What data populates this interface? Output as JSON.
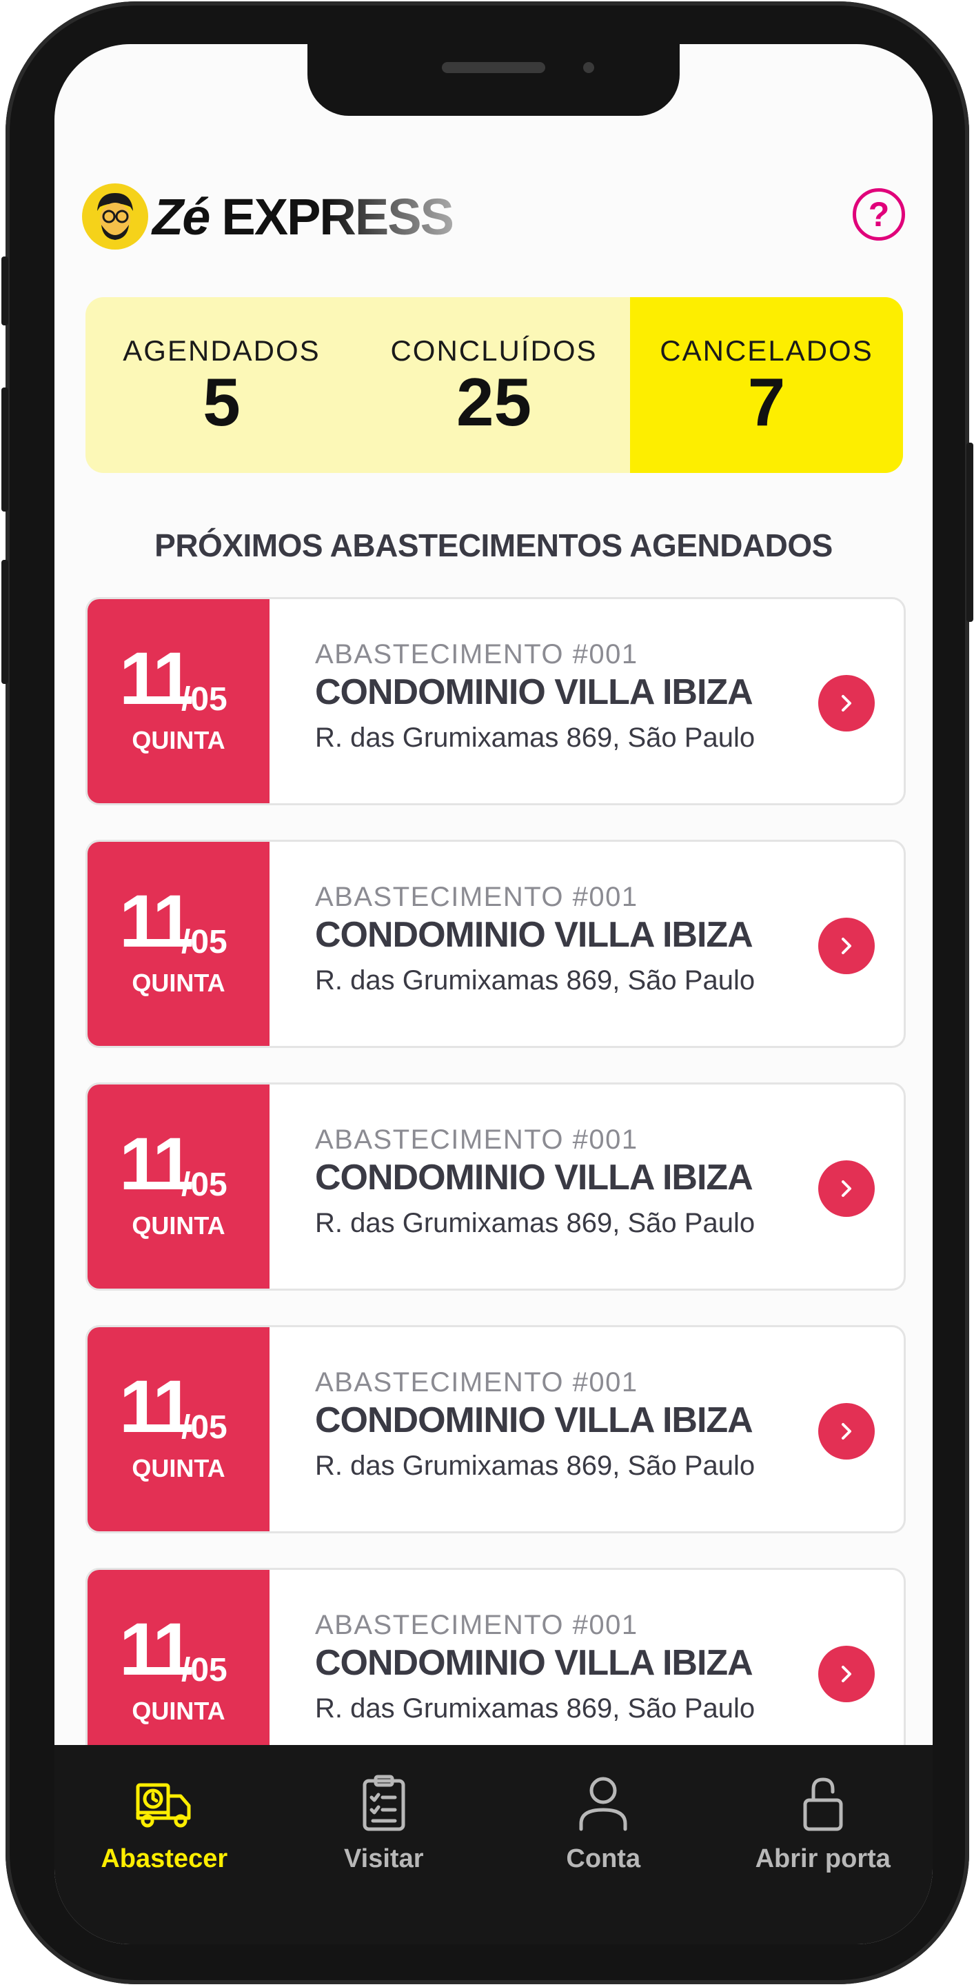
{
  "header": {
    "logo_text_ze": "Zé",
    "logo_text_express": "EXPRESS",
    "help_glyph": "?",
    "help_icon": "question-circle-icon",
    "accent_color": "#e0007a"
  },
  "stats": [
    {
      "label": "AGENDADOS",
      "value": "5",
      "active": false
    },
    {
      "label": "CONCLUÍDOS",
      "value": "25",
      "active": false
    },
    {
      "label": "CANCELADOS",
      "value": "7",
      "active": true
    }
  ],
  "section_title": "PRÓXIMOS ABASTECIMENTOS AGENDADOS",
  "appointments": [
    {
      "day": "11",
      "month": "/05",
      "weekday": "QUINTA",
      "id": "ABASTECIMENTO #001",
      "name": "CONDOMINIO VILLA IBIZA",
      "address": "R. das Grumixamas 869, São Paulo"
    },
    {
      "day": "11",
      "month": "/05",
      "weekday": "QUINTA",
      "id": "ABASTECIMENTO #001",
      "name": "CONDOMINIO VILLA IBIZA",
      "address": "R. das Grumixamas 869, São Paulo"
    },
    {
      "day": "11",
      "month": "/05",
      "weekday": "QUINTA",
      "id": "ABASTECIMENTO #001",
      "name": "CONDOMINIO VILLA IBIZA",
      "address": "R. das Grumixamas 869, São Paulo"
    },
    {
      "day": "11",
      "month": "/05",
      "weekday": "QUINTA",
      "id": "ABASTECIMENTO #001",
      "name": "CONDOMINIO VILLA IBIZA",
      "address": "R. das Grumixamas 869, São Paulo"
    },
    {
      "day": "11",
      "month": "/05",
      "weekday": "QUINTA",
      "id": "ABASTECIMENTO #001",
      "name": "CONDOMINIO VILLA IBIZA",
      "address": "R. das Grumixamas 869, São Paulo"
    }
  ],
  "nav": {
    "items": [
      {
        "label": "Abastecer",
        "icon": "delivery-truck-icon",
        "active": true
      },
      {
        "label": "Visitar",
        "icon": "clipboard-checklist-icon",
        "active": false
      },
      {
        "label": "Conta",
        "icon": "user-icon",
        "active": false
      },
      {
        "label": "Abrir porta",
        "icon": "unlock-icon",
        "active": false
      }
    ]
  },
  "colors": {
    "primary_red": "#e33054",
    "stats_bg": "#fcf8b7",
    "stats_active": "#fdee00",
    "nav_bg": "#171717",
    "nav_active": "#fdee00"
  }
}
